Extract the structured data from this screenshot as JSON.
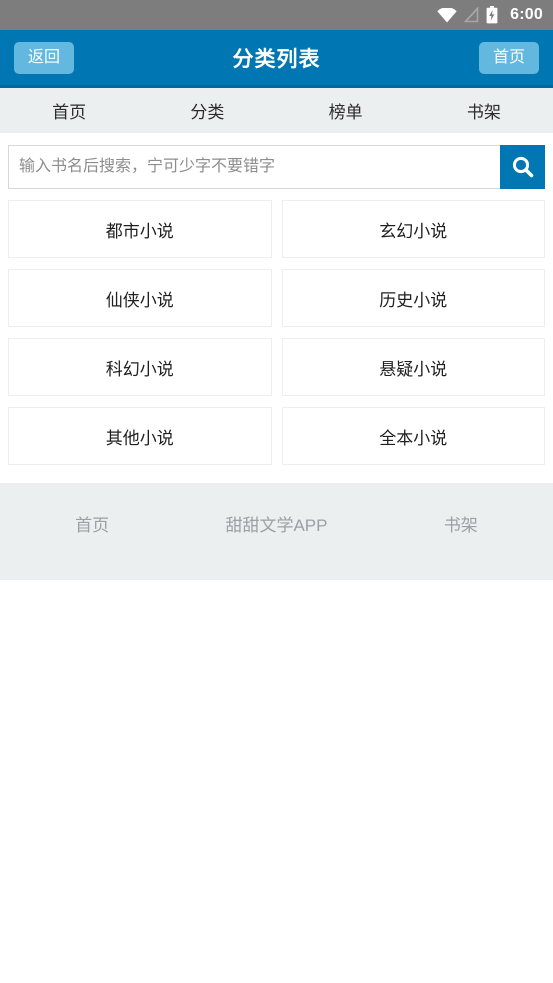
{
  "status_bar": {
    "time": "6:00",
    "icons": [
      {
        "name": "wifi-icon"
      },
      {
        "name": "signal-off-icon"
      },
      {
        "name": "battery-charging-icon"
      }
    ],
    "background_color": "#7d7d7d"
  },
  "header": {
    "title": "分类列表",
    "back_label": "返回",
    "home_label": "首页",
    "background_color": "#0077b2",
    "button_color": "#63b8e0"
  },
  "tabs": [
    {
      "label": "首页"
    },
    {
      "label": "分类"
    },
    {
      "label": "榜单"
    },
    {
      "label": "书架"
    }
  ],
  "search": {
    "placeholder": "输入书名后搜索，宁可少字不要错字",
    "value": "",
    "button_icon": "search-icon",
    "button_color": "#0077b2"
  },
  "categories": [
    {
      "label": "都市小说"
    },
    {
      "label": "玄幻小说"
    },
    {
      "label": "仙侠小说"
    },
    {
      "label": "历史小说"
    },
    {
      "label": "科幻小说"
    },
    {
      "label": "悬疑小说"
    },
    {
      "label": "其他小说"
    },
    {
      "label": "全本小说"
    }
  ],
  "footer": [
    {
      "label": "首页"
    },
    {
      "label": "甜甜文学APP"
    },
    {
      "label": "书架"
    }
  ]
}
